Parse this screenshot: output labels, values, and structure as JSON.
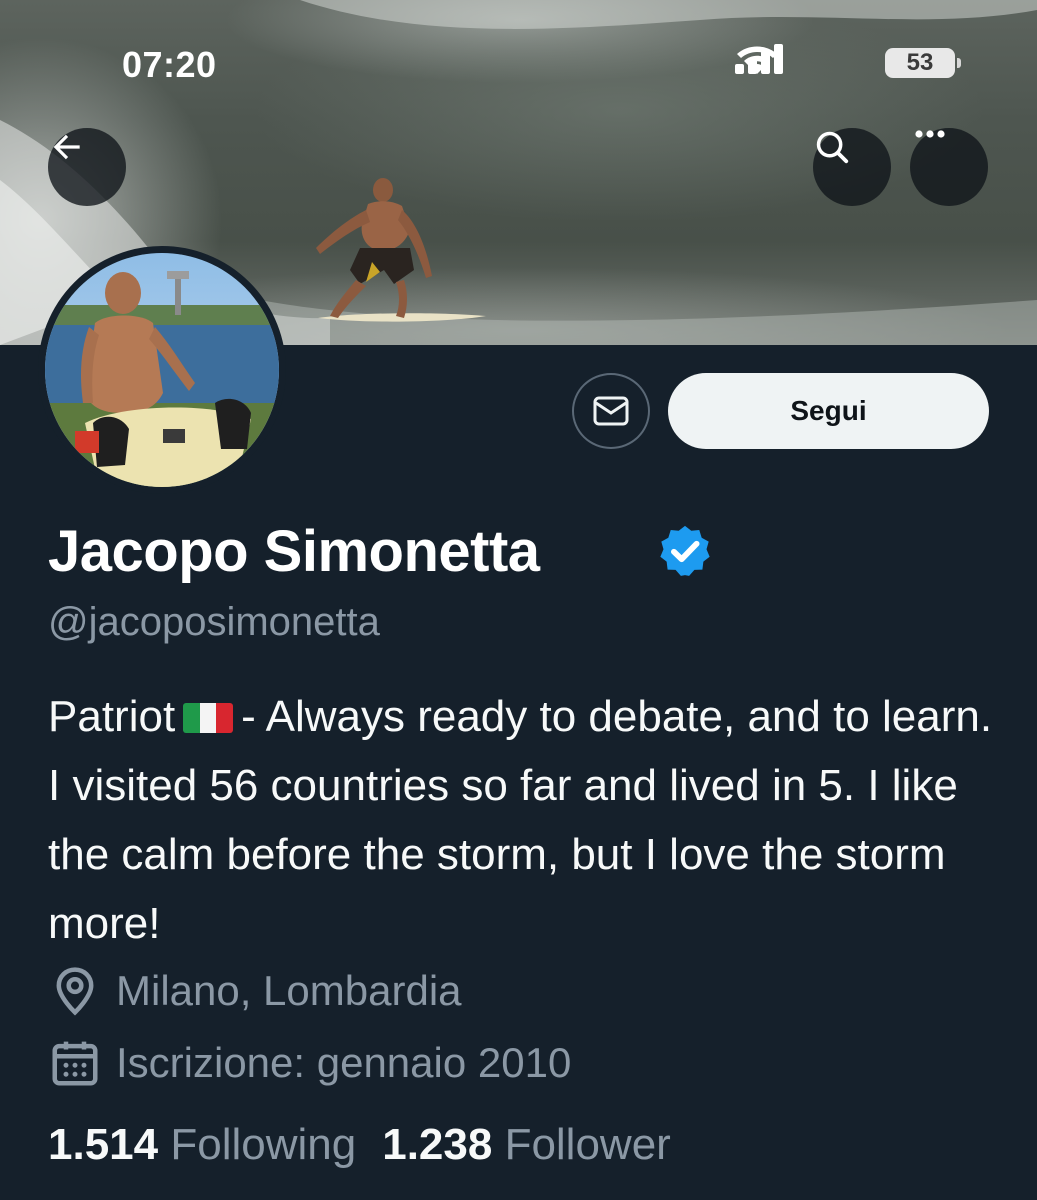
{
  "status_bar": {
    "time": "07:20",
    "battery": "53",
    "icons": [
      "signal-icon",
      "wifi-icon",
      "battery-icon"
    ]
  },
  "nav": {
    "icons": [
      "back-arrow-icon",
      "search-icon",
      "more-icon"
    ]
  },
  "profile": {
    "name": "Jacopo Simonetta",
    "handle": "@jacoposimonetta",
    "verified": true,
    "bio_part1": "Patriot",
    "bio_part2": "- Always ready to debate, and to learn. I visited 56 countries so far and lived in 5. I like the calm before the storm, but I love the storm more!",
    "location": "Milano, Lombardia",
    "joined": "Iscrizione: gennaio 2010",
    "following_count": "1.514",
    "following_label": "Following",
    "follower_count": "1.238",
    "follower_label": "Follower"
  },
  "actions": {
    "follow_label": "Segui",
    "message_icon": "envelope-icon"
  },
  "colors": {
    "background": "#15202b",
    "secondary_text": "#8b98a5",
    "verified_blue": "#1d9bf0",
    "follow_button": "#eff3f4"
  }
}
